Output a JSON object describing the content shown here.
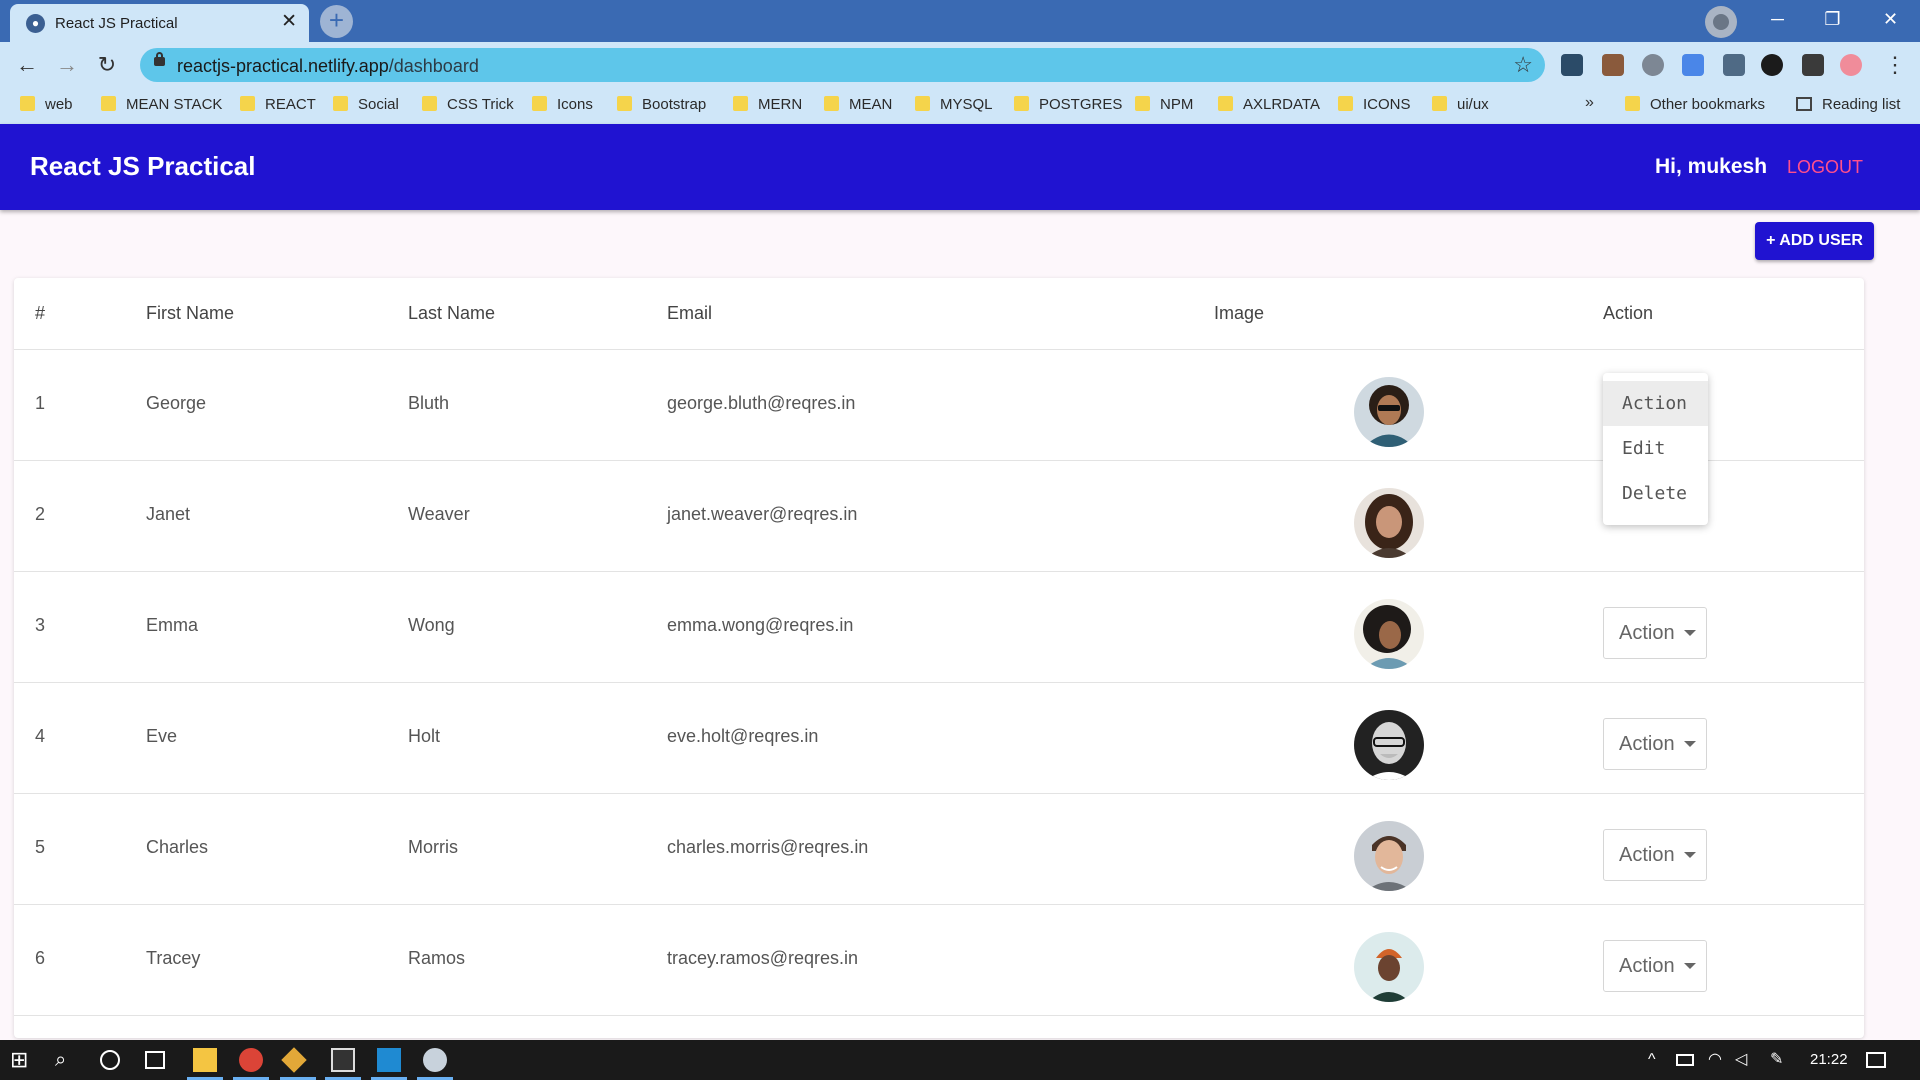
{
  "browser": {
    "tab_title": "React JS Practical",
    "tab_close": "✕",
    "new_tab": "+",
    "url_host": "reactjs-practical.netlify.app",
    "url_path": "/dashboard",
    "minimize": "─",
    "restore": "❐",
    "close": "✕",
    "bookmarks": [
      "web",
      "MEAN STACK",
      "REACT",
      "Social",
      "CSS Trick",
      "Icons",
      "Bootstrap",
      "MERN",
      "MEAN",
      "MYSQL",
      "POSTGRES",
      "NPM",
      "AXLRDATA",
      "ICONS",
      "ui/ux"
    ],
    "bookmarks_more": "»",
    "other_bookmarks": "Other bookmarks",
    "reading_list": "Reading list"
  },
  "app": {
    "title": "React JS Practical",
    "greeting": "Hi, mukesh",
    "logout": "LOGOUT",
    "add_user": "+ ADD USER"
  },
  "table": {
    "headers": [
      "#",
      "First Name",
      "Last Name",
      "Email",
      "Image",
      "Action"
    ],
    "rows": [
      {
        "id": "1",
        "first": "George",
        "last": "Bluth",
        "email": "george.bluth@reqres.in"
      },
      {
        "id": "2",
        "first": "Janet",
        "last": "Weaver",
        "email": "janet.weaver@reqres.in"
      },
      {
        "id": "3",
        "first": "Emma",
        "last": "Wong",
        "email": "emma.wong@reqres.in"
      },
      {
        "id": "4",
        "first": "Eve",
        "last": "Holt",
        "email": "eve.holt@reqres.in"
      },
      {
        "id": "5",
        "first": "Charles",
        "last": "Morris",
        "email": "charles.morris@reqres.in"
      },
      {
        "id": "6",
        "first": "Tracey",
        "last": "Ramos",
        "email": "tracey.ramos@reqres.in"
      }
    ],
    "action_label": "Action",
    "menu_options": [
      "Action",
      "Edit",
      "Delete"
    ]
  },
  "taskbar": {
    "time": "21:22"
  },
  "colors": {
    "appbar": "#2013d1",
    "logout": "#ff4f8b",
    "tab_strip": "#3a6ab3",
    "toolbar": "#cfe6f8"
  }
}
